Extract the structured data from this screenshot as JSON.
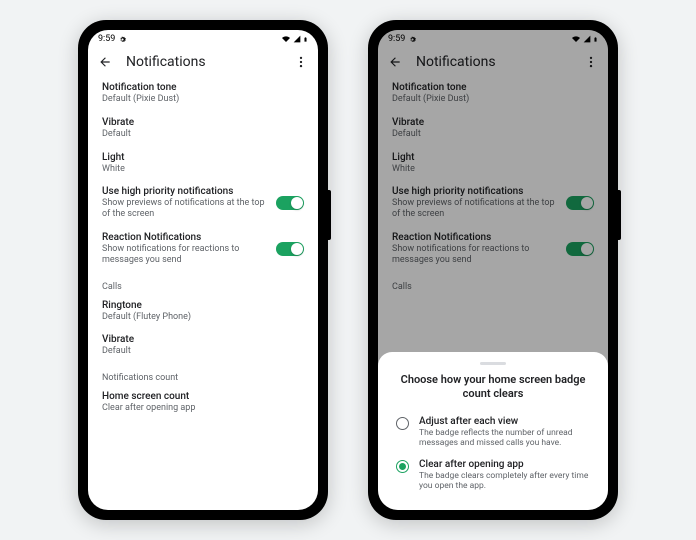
{
  "status": {
    "time": "9:59"
  },
  "header": {
    "title": "Notifications"
  },
  "items": {
    "tone": {
      "title": "Notification tone",
      "sub": "Default (Pixie Dust)"
    },
    "vibrate": {
      "title": "Vibrate",
      "sub": "Default"
    },
    "light": {
      "title": "Light",
      "sub": "White"
    },
    "priority": {
      "title": "Use high priority notifications",
      "sub": "Show previews of notifications at the top of the screen"
    },
    "reaction": {
      "title": "Reaction Notifications",
      "sub": "Show notifications for reactions to messages you send"
    },
    "ringtone": {
      "title": "Ringtone",
      "sub": "Default (Flutey Phone)"
    },
    "vibrate2": {
      "title": "Vibrate",
      "sub": "Default"
    },
    "home": {
      "title": "Home screen count",
      "sub": "Clear after opening app"
    }
  },
  "sections": {
    "calls": "Calls",
    "count": "Notifications count"
  },
  "sheet": {
    "title": "Choose how your home screen badge count clears",
    "opt1": {
      "title": "Adjust after each view",
      "sub": "The badge reflects the number of unread messages and missed calls you have."
    },
    "opt2": {
      "title": "Clear after opening app",
      "sub": "The badge clears completely after every time you open the app."
    }
  }
}
